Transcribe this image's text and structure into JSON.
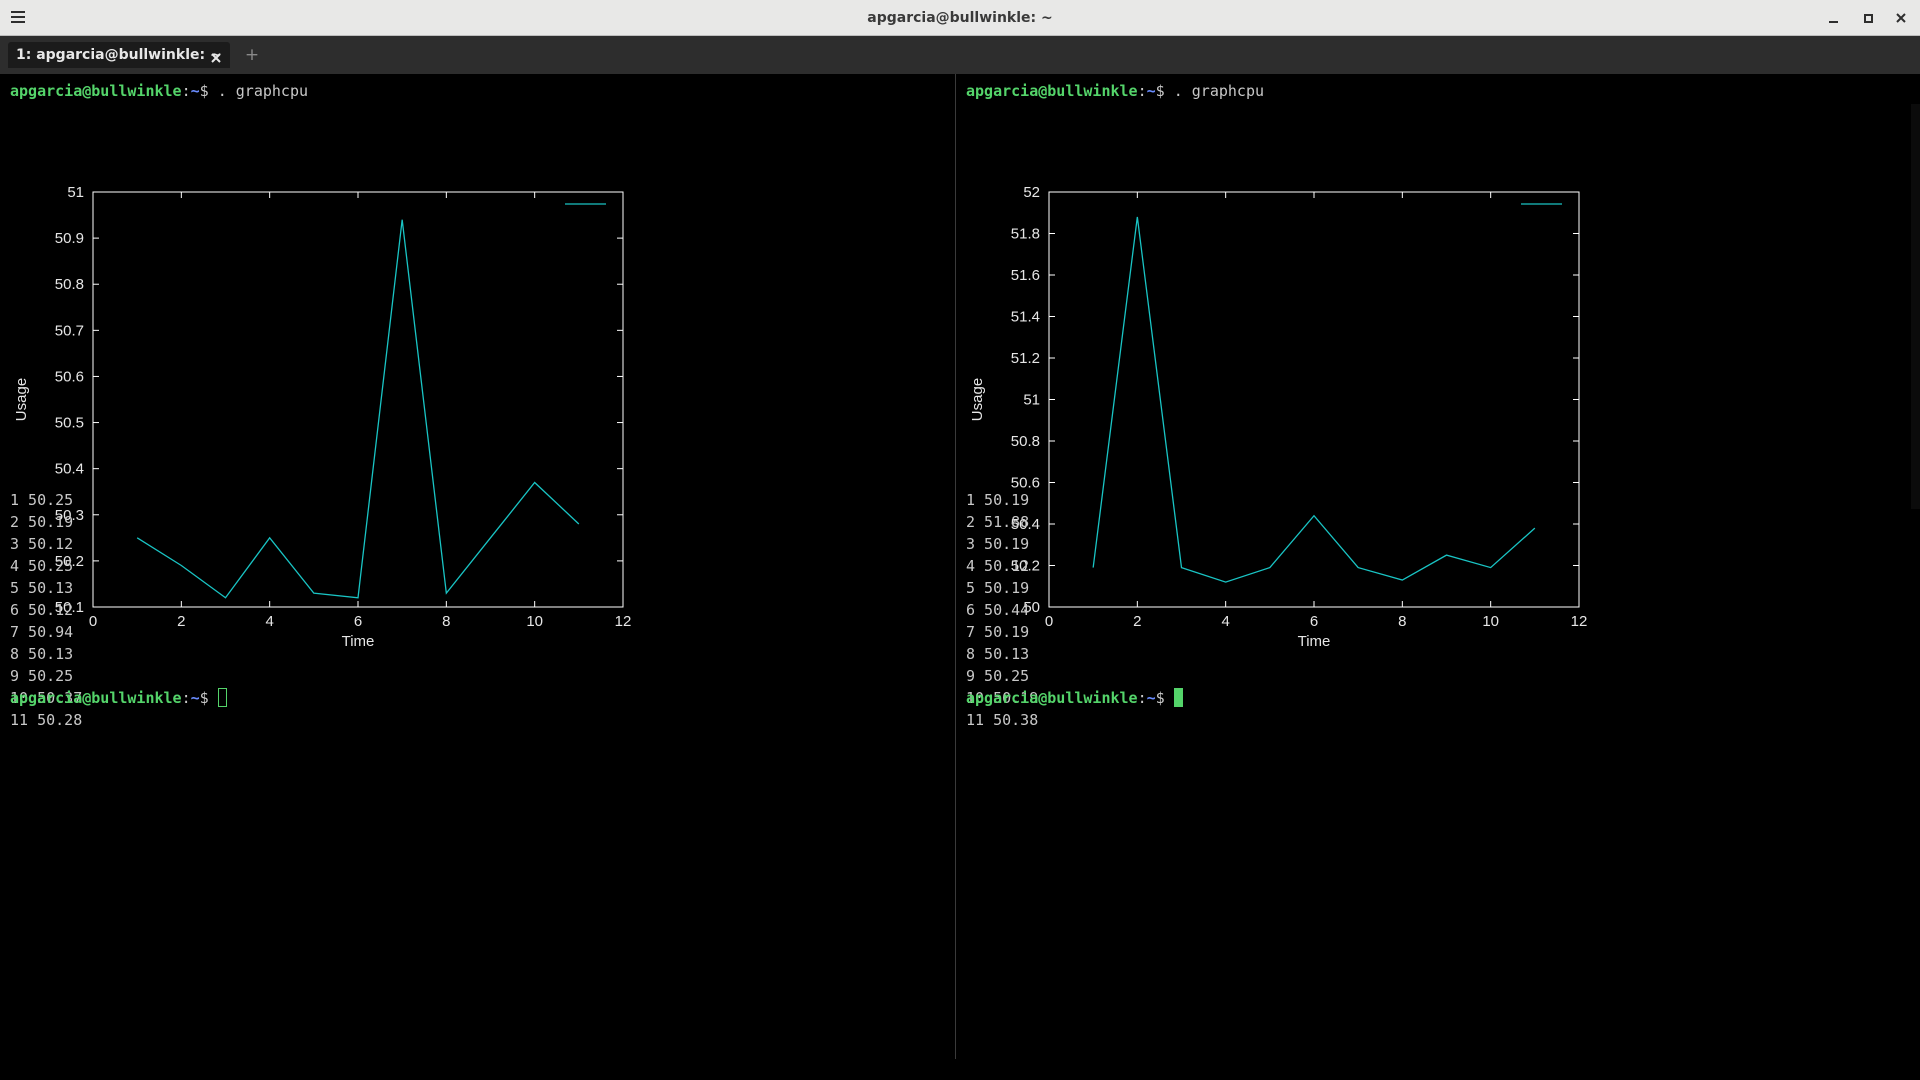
{
  "window": {
    "title": "apgarcia@bullwinkle: ~",
    "tab_label": "1: apgarcia@bullwinkle: ~",
    "new_tab_label": "+"
  },
  "prompt": {
    "user": "apgarcia@bullwinkle",
    "sep": ":",
    "path": "~",
    "dollar": "$",
    "command": " . graphcpu"
  },
  "colors": {
    "prompt_user": "#54d46a",
    "prompt_path": "#6a8cff",
    "plot_line": "#19c4c4",
    "plot_axes": "#ffffff",
    "terminal_bg": "#000000"
  },
  "icons": {
    "menu": "hamburger-icon",
    "minimize": "minimize-icon",
    "maximize": "maximize-icon",
    "close": "close-icon",
    "tab_close": "close-icon",
    "new_tab": "plus-icon"
  },
  "left": {
    "output": [
      "1 50.25",
      "2 50.19",
      "3 50.12",
      "4 50.25",
      "5 50.13",
      "6 50.12",
      "7 50.94",
      "8 50.13",
      "9 50.25",
      "10 50.37",
      "11 50.28"
    ],
    "cursor": "hollow"
  },
  "right": {
    "output": [
      "1 50.19",
      "2 51.88",
      "3 50.19",
      "4 50.12",
      "5 50.19",
      "6 50.44",
      "7 50.19",
      "8 50.13",
      "9 50.25",
      "10 50.19",
      "11 50.38"
    ],
    "cursor": "solid"
  },
  "chart_data": [
    {
      "type": "line",
      "title": "",
      "xlabel": "Time",
      "ylabel": "Usage",
      "xlim": [
        0,
        12
      ],
      "ylim": [
        50.1,
        51
      ],
      "xticks": [
        0,
        2,
        4,
        6,
        8,
        10,
        12
      ],
      "xtick_labels": [
        "0",
        "2",
        "4",
        "6",
        "8",
        "10",
        "12"
      ],
      "yticks": [
        50.1,
        50.2,
        50.3,
        50.4,
        50.5,
        50.6,
        50.7,
        50.8,
        50.9,
        51
      ],
      "ytick_labels": [
        "50.1",
        "50.2",
        "50.3",
        "50.4",
        "50.5",
        "50.6",
        "50.7",
        "50.8",
        "50.9",
        "51"
      ],
      "grid": false,
      "legend": "top-right",
      "series": [
        {
          "x": [
            1,
            2,
            3,
            4,
            5,
            6,
            7,
            8,
            9,
            10,
            11
          ],
          "values": [
            50.25,
            50.19,
            50.12,
            50.25,
            50.13,
            50.12,
            50.94,
            50.13,
            50.25,
            50.37,
            50.28
          ]
        }
      ]
    },
    {
      "type": "line",
      "title": "",
      "xlabel": "Time",
      "ylabel": "Usage",
      "xlim": [
        0,
        12
      ],
      "ylim": [
        50,
        52
      ],
      "xticks": [
        0,
        2,
        4,
        6,
        8,
        10,
        12
      ],
      "xtick_labels": [
        "0",
        "2",
        "4",
        "6",
        "8",
        "10",
        "12"
      ],
      "yticks": [
        50,
        50.2,
        50.4,
        50.6,
        50.8,
        51,
        51.2,
        51.4,
        51.6,
        51.8,
        52
      ],
      "ytick_labels": [
        "50",
        "50.2",
        "50.4",
        "50.6",
        "50.8",
        "51",
        "51.2",
        "51.4",
        "51.6",
        "51.8",
        "52"
      ],
      "grid": false,
      "legend": "top-right",
      "series": [
        {
          "x": [
            1,
            2,
            3,
            4,
            5,
            6,
            7,
            8,
            9,
            10,
            11
          ],
          "values": [
            50.19,
            51.88,
            50.19,
            50.12,
            50.19,
            50.44,
            50.19,
            50.13,
            50.25,
            50.19,
            50.38
          ]
        }
      ]
    }
  ]
}
